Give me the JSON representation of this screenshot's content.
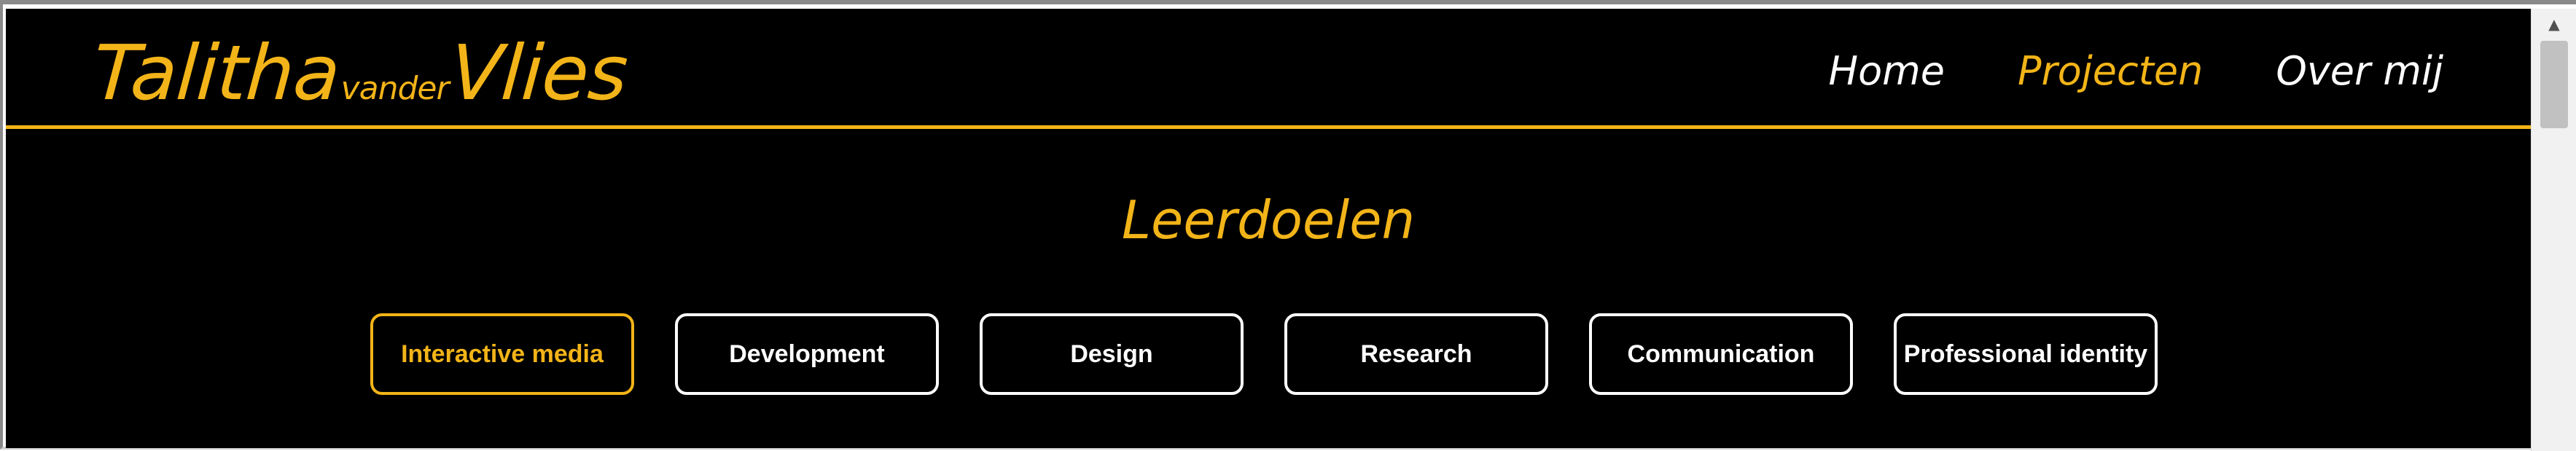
{
  "header": {
    "logo": {
      "first": "Talitha",
      "middle": "vander",
      "last": "Vlies"
    },
    "nav": [
      {
        "label": "Home",
        "active": false
      },
      {
        "label": "Projecten",
        "active": true
      },
      {
        "label": "Over mij",
        "active": false
      }
    ]
  },
  "main": {
    "heading": "Leerdoelen",
    "tabs": [
      {
        "label": "Interactive media",
        "active": true
      },
      {
        "label": "Development",
        "active": false
      },
      {
        "label": "Design",
        "active": false
      },
      {
        "label": "Research",
        "active": false
      },
      {
        "label": "Communication",
        "active": false
      },
      {
        "label": "Professional identity",
        "active": false
      }
    ]
  },
  "colors": {
    "accent": "#f2b418",
    "background": "#000000",
    "text": "#ffffff"
  }
}
